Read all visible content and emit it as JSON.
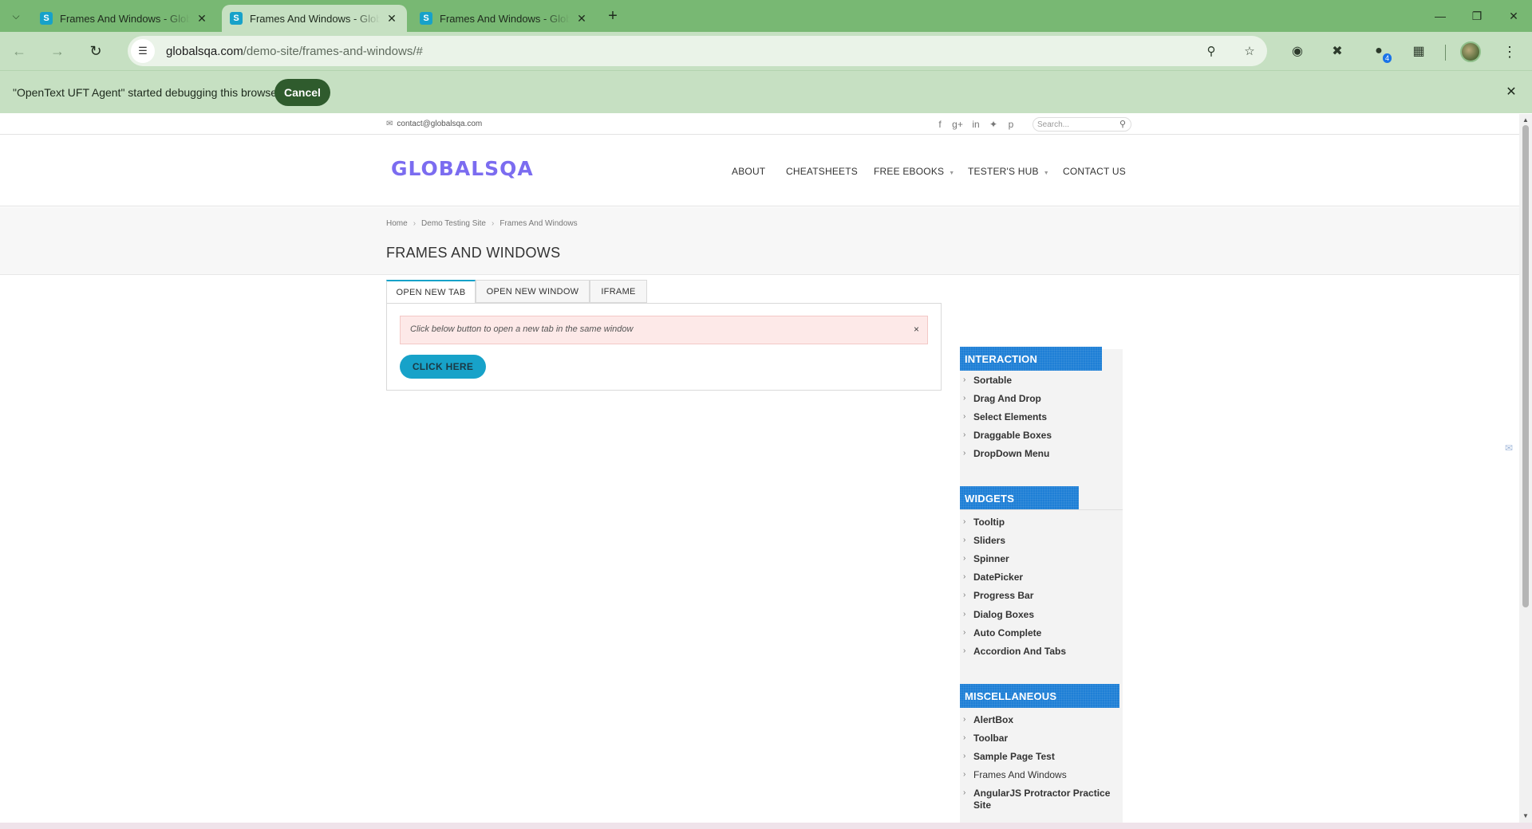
{
  "browser": {
    "tabs": [
      {
        "title": "Frames And Windows - GlobalSQA",
        "favicon": "S",
        "active": false
      },
      {
        "title": "Frames And Windows - GlobalSQA",
        "favicon": "S",
        "active": true
      },
      {
        "title": "Frames And Windows - GlobalSQA",
        "favicon": "S",
        "active": false
      }
    ],
    "url_host": "globalsqa.com",
    "url_path": "/demo-site/frames-and-windows/#",
    "extension_badge": "4",
    "infobar_text": "\"OpenText UFT Agent\" started debugging this browser",
    "infobar_cancel": "Cancel"
  },
  "site": {
    "contact_email": "contact@globalsqa.com",
    "search_placeholder": "Search...",
    "logo": "GLOBALSQA",
    "nav": [
      {
        "label": "ABOUT",
        "has_dropdown": false
      },
      {
        "label": "CHEATSHEETS",
        "has_dropdown": false
      },
      {
        "label": "FREE EBOOKS",
        "has_dropdown": true
      },
      {
        "label": "TESTER'S HUB",
        "has_dropdown": true
      },
      {
        "label": "CONTACT US",
        "has_dropdown": false
      }
    ],
    "breadcrumb": [
      "Home",
      "Demo Testing Site",
      "Frames And Windows"
    ],
    "page_title": "FRAMES AND WINDOWS"
  },
  "demo": {
    "tabs": [
      "OPEN NEW TAB",
      "OPEN NEW WINDOW",
      "IFRAME"
    ],
    "active_tab": "OPEN NEW TAB",
    "alert_text": "Click below button to open a new tab in the same window",
    "alert_close": "×",
    "button_label": "CLICK HERE"
  },
  "sidebar": {
    "sections": [
      {
        "title": "INTERACTION",
        "items": [
          "Sortable",
          "Drag And Drop",
          "Select Elements",
          "Draggable Boxes",
          "DropDown Menu"
        ]
      },
      {
        "title": "WIDGETS",
        "items": [
          "Tooltip",
          "Sliders",
          "Spinner",
          "DatePicker",
          "Progress Bar",
          "Dialog Boxes",
          "Auto Complete",
          "Accordion And Tabs"
        ]
      },
      {
        "title": "MISCELLANEOUS",
        "items": [
          "AlertBox",
          "Toolbar",
          "Sample Page Test",
          "Frames And Windows",
          "AngularJS Protractor Practice",
          "Site"
        ]
      }
    ]
  },
  "colors": {
    "tabstrip": "#78b873",
    "toolbar": "#c6e0c2",
    "accent": "#17a2c9",
    "logo": "#7b6cf0",
    "widget_header": "#1e7fd6",
    "alert_bg": "#fde9e8"
  }
}
